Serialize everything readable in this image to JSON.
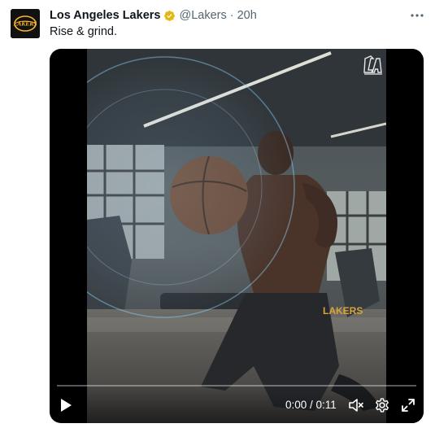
{
  "tweet": {
    "author": {
      "name": "Los Angeles Lakers",
      "handle": "@Lakers",
      "separator": "·",
      "time": "20h",
      "avatar_logo_text": "LAKERS",
      "verified_badge_color": "#e2b714"
    },
    "text": "Rise & grind.",
    "more_icon": "more-horizontal-icon"
  },
  "video": {
    "watermark_icon": "lakers-la-logo",
    "progress_fraction": 0,
    "time_display": "0:00 / 0:11",
    "controls": {
      "play_icon": "play-icon",
      "mute_icon": "volume-muted-icon",
      "settings_icon": "gear-icon",
      "fullscreen_icon": "expand-icon"
    }
  },
  "colors": {
    "text_primary": "#0f1419",
    "text_secondary": "#536471",
    "lakers_gold": "#fdb927",
    "lakers_purple": "#552583"
  }
}
